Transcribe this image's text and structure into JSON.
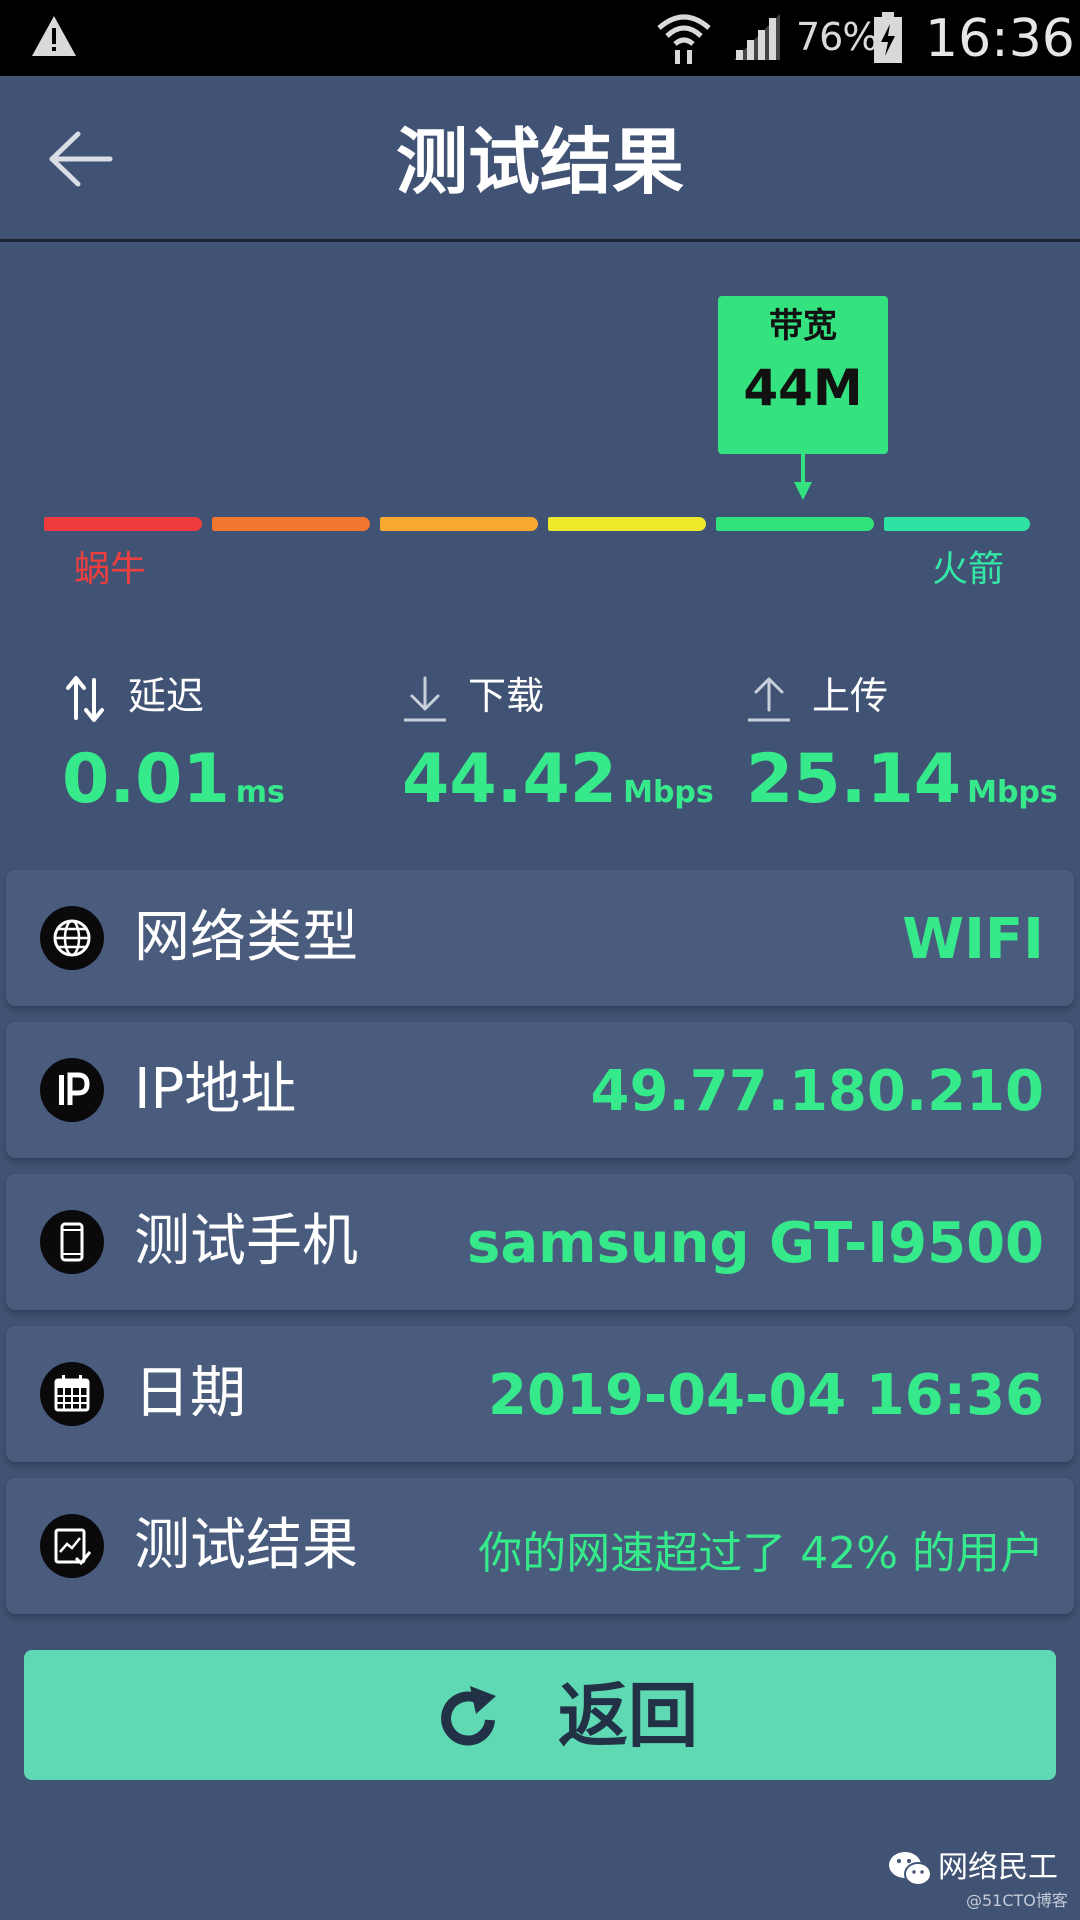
{
  "status_bar": {
    "battery_percent": "76%",
    "time": "16:36"
  },
  "header": {
    "title": "测试结果"
  },
  "gauge": {
    "callout_label": "带宽",
    "callout_value": "44M",
    "left_label": "蜗牛",
    "right_label": "火箭",
    "segment_colors": [
      "#ee3b3b",
      "#f2762e",
      "#f7a830",
      "#ede82a",
      "#31e27a",
      "#2de3a4"
    ],
    "marker_segment": 5
  },
  "metrics": [
    {
      "label": "延迟",
      "value": "0.01",
      "unit": "ms",
      "icon": "latency-icon"
    },
    {
      "label": "下载",
      "value": "44.42",
      "unit": "Mbps",
      "icon": "download-icon"
    },
    {
      "label": "上传",
      "value": "25.14",
      "unit": "Mbps",
      "icon": "upload-icon"
    }
  ],
  "info": {
    "network_type": {
      "label": "网络类型",
      "value": "WIFI",
      "icon": "globe-icon"
    },
    "ip": {
      "label": "IP地址",
      "value": "49.77.180.210",
      "icon": "ip-icon"
    },
    "device": {
      "label": "测试手机",
      "value": "samsung GT-I9500",
      "icon": "phone-icon"
    },
    "date": {
      "label": "日期",
      "value": "2019-04-04 16:36",
      "icon": "calendar-icon"
    },
    "result": {
      "label": "测试结果",
      "value": "你的网速超过了 42% 的用户",
      "icon": "chart-icon"
    }
  },
  "actions": {
    "return_label": "返回"
  },
  "watermark": {
    "brand": "网络民工",
    "site": "@51CTO博客"
  },
  "colors": {
    "background": "#415374",
    "accent_green": "#36e98a",
    "button_teal": "#5fd8b4"
  }
}
